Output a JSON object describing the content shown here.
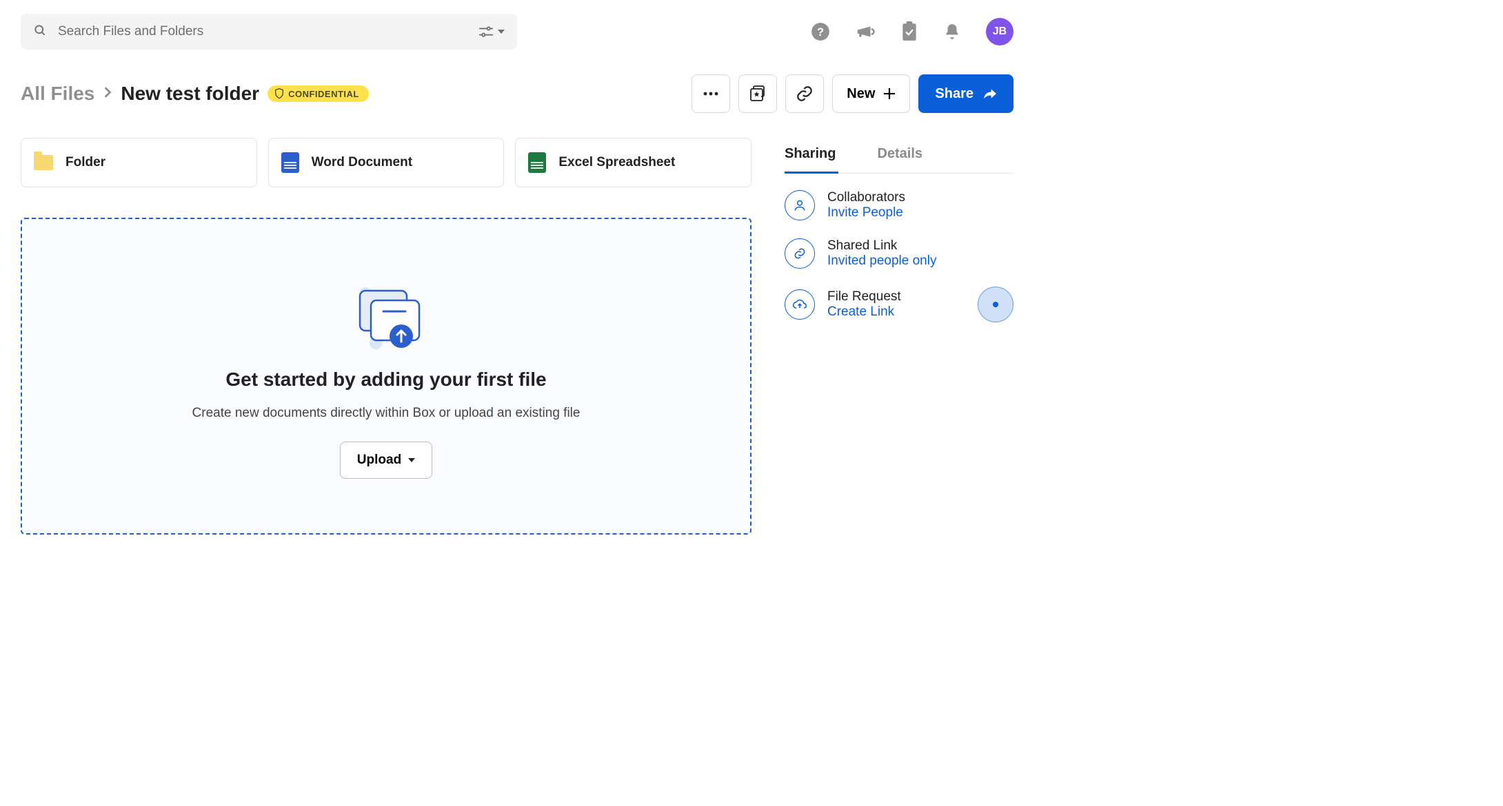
{
  "search": {
    "placeholder": "Search Files and Folders"
  },
  "user": {
    "initials": "JB"
  },
  "breadcrumb": {
    "root": "All Files",
    "current": "New test folder"
  },
  "badge": {
    "label": "CONFIDENTIAL"
  },
  "actions": {
    "new": "New",
    "share": "Share"
  },
  "cards": [
    {
      "label": "Folder"
    },
    {
      "label": "Word Document"
    },
    {
      "label": "Excel Spreadsheet"
    }
  ],
  "dropzone": {
    "title": "Get started by adding your first file",
    "subtitle": "Create new documents directly within Box or upload an existing file",
    "upload": "Upload"
  },
  "sidebar": {
    "tabs": {
      "sharing": "Sharing",
      "details": "Details",
      "active": "sharing"
    },
    "items": [
      {
        "title": "Collaborators",
        "link": "Invite People"
      },
      {
        "title": "Shared Link",
        "link": "Invited people only"
      },
      {
        "title": "File Request",
        "link": "Create Link"
      }
    ]
  }
}
